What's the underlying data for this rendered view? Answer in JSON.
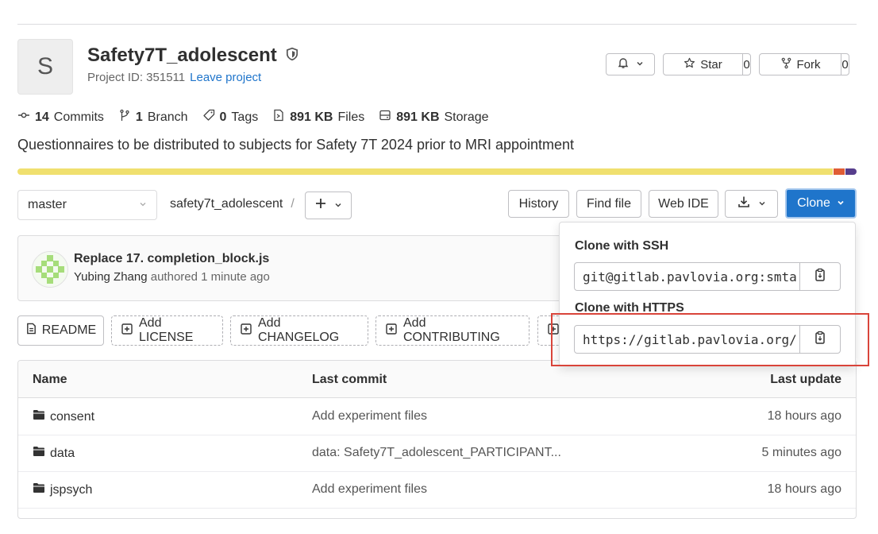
{
  "project": {
    "avatar_letter": "S",
    "name": "Safety7T_adolescent",
    "id_text": "Project ID: 351511",
    "leave_link": "Leave project"
  },
  "actions": {
    "star_label": "Star",
    "star_count": "0",
    "fork_label": "Fork",
    "fork_count": "0"
  },
  "stats": {
    "commits_count": "14",
    "commits_label": "Commits",
    "branch_count": "1",
    "branch_label": "Branch",
    "tags_count": "0",
    "tags_label": "Tags",
    "files_size": "891 KB",
    "files_label": "Files",
    "storage_size": "891 KB",
    "storage_label": "Storage"
  },
  "description": "Questionnaires to be distributed to subjects for Safety 7T 2024 prior to MRI appointment",
  "language_bar": [
    {
      "color": "#f0e06f",
      "fraction": 0.973
    },
    {
      "color": "#e05d35",
      "fraction": 0.014
    },
    {
      "color": "#563d8c",
      "fraction": 0.013
    }
  ],
  "repo_nav": {
    "branch": "master",
    "path": "safety7t_adolescent",
    "separator": "/",
    "history": "History",
    "find_file": "Find file",
    "web_ide": "Web IDE",
    "clone": "Clone"
  },
  "last_commit": {
    "title": "Replace 17. completion_block.js",
    "author": "Yubing Zhang",
    "action": "authored",
    "time": "1 minute ago"
  },
  "shortcuts": {
    "readme": "README",
    "add_license": "Add LICENSE",
    "add_changelog": "Add CHANGELOG",
    "add_contributing": "Add CONTRIBUTING"
  },
  "clone_dropdown": {
    "ssh_label": "Clone with SSH",
    "ssh_url": "git@gitlab.pavlovia.org:smta",
    "https_label": "Clone with HTTPS",
    "https_url": "https://gitlab.pavlovia.org/"
  },
  "table": {
    "headers": {
      "name": "Name",
      "last_commit": "Last commit",
      "last_update": "Last update"
    },
    "rows": [
      {
        "name": "consent",
        "commit": "Add experiment files",
        "updated": "18 hours ago"
      },
      {
        "name": "data",
        "commit": "data: Safety7T_adolescent_PARTICIPANT...",
        "updated": "5 minutes ago"
      },
      {
        "name": "jspsych",
        "commit": "Add experiment files",
        "updated": "18 hours ago"
      }
    ]
  }
}
